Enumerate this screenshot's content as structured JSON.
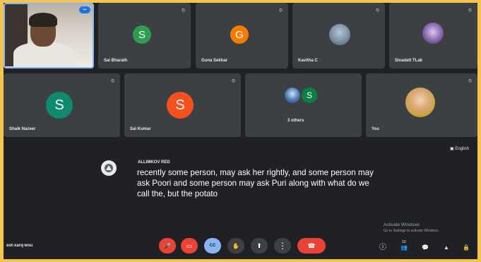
{
  "participants": [
    {
      "name": "",
      "initial": "",
      "has_video": true,
      "active": true
    },
    {
      "name": "Sai Bharath",
      "initial": "S",
      "color": "#2e9d52"
    },
    {
      "name": "Guna Sekhar",
      "initial": "G",
      "color": "#f57c00"
    },
    {
      "name": "Kavitha C",
      "initial": "",
      "photo": true
    },
    {
      "name": "Sivadatt TLak",
      "initial": "",
      "photo": true
    },
    {
      "name": "Shaik Nazeer",
      "initial": "S",
      "color": "#0f8a6f"
    },
    {
      "name": "Sai Kumar",
      "initial": "S",
      "color": "#f4511e"
    },
    {
      "name": "3 others",
      "initial": "S",
      "color": "#0b8043",
      "group": true
    },
    {
      "name": "You",
      "initial": "",
      "photo": true
    }
  ],
  "caption": {
    "speaker": "ALLIMKOV RED",
    "text": "recently some person, may ask her rightly, and some person may ask Poori and some person may ask Puri along with what do we call the, but the potato"
  },
  "caption_language": "English",
  "meeting_code": "eot-xarq-wxu",
  "sticky_notice": {
    "line1": "Activate Windows",
    "line2": "Go to Settings to activate Windows."
  },
  "controls": [
    {
      "name": "mic-off-button",
      "icon": "mic-off-icon",
      "glyph": "🎤",
      "color": "#ea4335"
    },
    {
      "name": "camera-off-button",
      "icon": "camera-off-icon",
      "glyph": "▭",
      "color": "#ea4335"
    },
    {
      "name": "captions-button",
      "icon": "captions-icon",
      "glyph": "CC",
      "color": "#8ab4f8"
    },
    {
      "name": "raise-hand-button",
      "icon": "hand-icon",
      "glyph": "✋",
      "color": "#3c4043"
    },
    {
      "name": "present-button",
      "icon": "present-icon",
      "glyph": "⬆",
      "color": "#3c4043"
    },
    {
      "name": "more-options-button",
      "icon": "more-vert-icon",
      "glyph": "⋮",
      "color": "#3c4043"
    },
    {
      "name": "leave-call-button",
      "icon": "phone-hangup-icon",
      "glyph": "☎",
      "color": "#ea4335"
    }
  ],
  "right_controls": [
    {
      "name": "info-button",
      "icon": "info-icon",
      "glyph": "ⓘ"
    },
    {
      "name": "people-button",
      "icon": "people-icon",
      "glyph": "👥",
      "badge": "10"
    },
    {
      "name": "chat-button",
      "icon": "chat-icon",
      "glyph": "💬"
    },
    {
      "name": "activities-button",
      "icon": "activities-icon",
      "glyph": "▲"
    },
    {
      "name": "host-controls-button",
      "icon": "lock-person-icon",
      "glyph": "🔒"
    }
  ]
}
